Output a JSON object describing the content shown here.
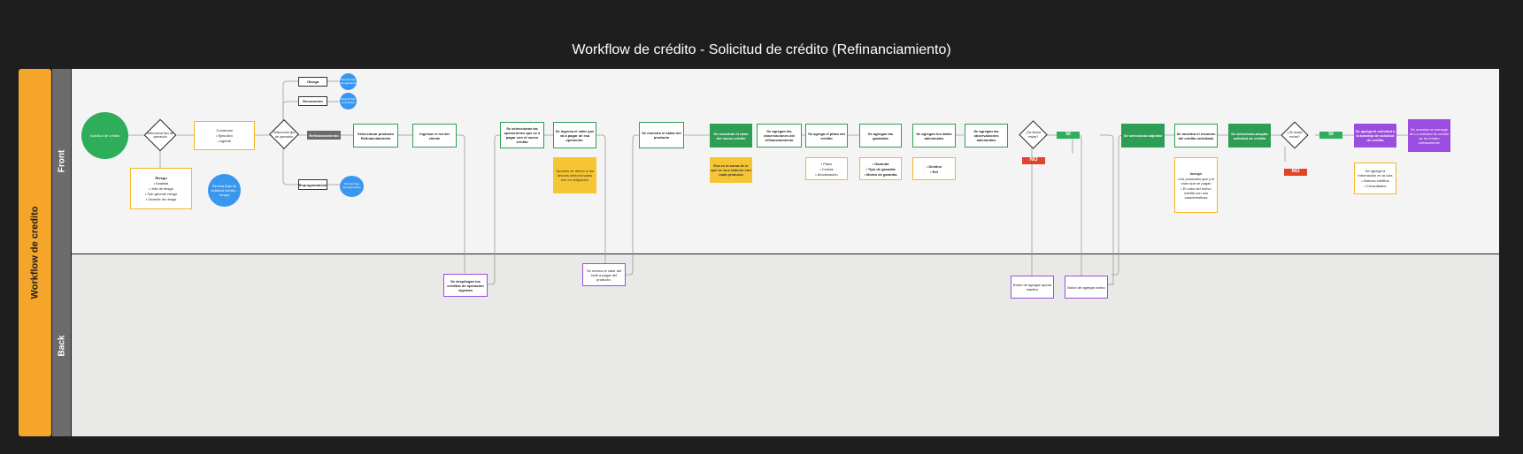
{
  "title": "Workflow de crédito - Solicitud de crédito (Refinanciamiento)",
  "pool_label": "Workflow de credito",
  "lanes": {
    "front": "Front",
    "back": "Back"
  },
  "nodes": {
    "start": "Solicitud de crédito",
    "d1": "Seleccionar tipo de operación",
    "comercial_title": "Comercial",
    "comercial_items": [
      "• Ejecutivo",
      "• Agente"
    ],
    "riesgo_title": "Riesgo",
    "riesgo_items": [
      "• Analista",
      "• Jefe de riesgo",
      "• Sub gerente riesgo",
      "• Gerente de riesgo"
    ],
    "flujo_riesgo": "Revisar flujo de solicitud crédito - riesgo",
    "d2": "Seleccionar tipo de operación",
    "otorga": "Otorga",
    "otorga_c": "Revisar flujo otorgamiento",
    "renovacion": "Renovación",
    "renovacion_c": "Revisar flujo renovación",
    "refin": "Refinanciamiento",
    "reprog": "Reprogramación",
    "reprog_c": "Revisar flujo reprogramación",
    "sel_producto": "Seleccionar producto Refinanciamiento",
    "ingresar_rut": "Ingresar el rut del cliente",
    "despliegan": "Se despliegan los créditos de operación vigentes",
    "sel_ops": "Se seleccionan las operaciones que se a pagar con el nuevo crédito",
    "ingresa_valor": "Se ingresa el valor que va a pagar de esa operación.",
    "nota_yellow": "También se afirma si las deudas seleccionadas son en obligación",
    "retorna": "Se retorna el valor del total a pagar del producto.",
    "muestra_saldo": "Se muestra el saldo del producto",
    "muestra_valor": "Se muestran el valor del nuevo crédito",
    "nota_suma": "Esa es la suma de lo que se va a obtener con cada producto",
    "obs": "Se agregan las observaciones del refinanciamiento",
    "avales": "Se agrega el plazo del crédito",
    "avales_items": [
      "• Plazo",
      "• Cuotas",
      "• Amortización"
    ],
    "garantias": "Se agregan las garantías",
    "garantias_items": [
      "• Garantía",
      "• Tipo de garantía",
      "• Monto de garantía"
    ],
    "datos": "Se agregan los datos adicionales",
    "datos_items": [
      "• Destino",
      "• Rol"
    ],
    "obs2": "Se agregan las observaciones adicionales",
    "d3": "¿Se desea enviar?",
    "d3_no": "NO",
    "d3_si": "SI",
    "bloqueo1": "Botón de agregar queda inactivo",
    "bloqueo2": "Botón de agregar activo",
    "sel_adjunto": "Se selecciona adjuntar",
    "muestra_resumen": "Se muestra el resumen del crédito solicitado",
    "resumen_title": "Incluye",
    "resumen_items": [
      "• los productos que y el valor que se pagan",
      "• El valor del nuevo crédito con sus características"
    ],
    "sel_aceptar": "Se selecciona aceptar solicitud de crédito",
    "d4": "¿Se desea enviar?",
    "d4_no": "NO",
    "d4_si": "SI",
    "agrega_bandeja": "Se agrega la solicitud a la bandeja de solicitud de crédito",
    "mensaje": "Se muestra un mensaje de La solicitud de crédito se ha creado exitosamente",
    "cola_title": "Se agrega la información en la cola",
    "cola_items": [
      "• Nuevos créditos",
      "• Consultados"
    ]
  }
}
